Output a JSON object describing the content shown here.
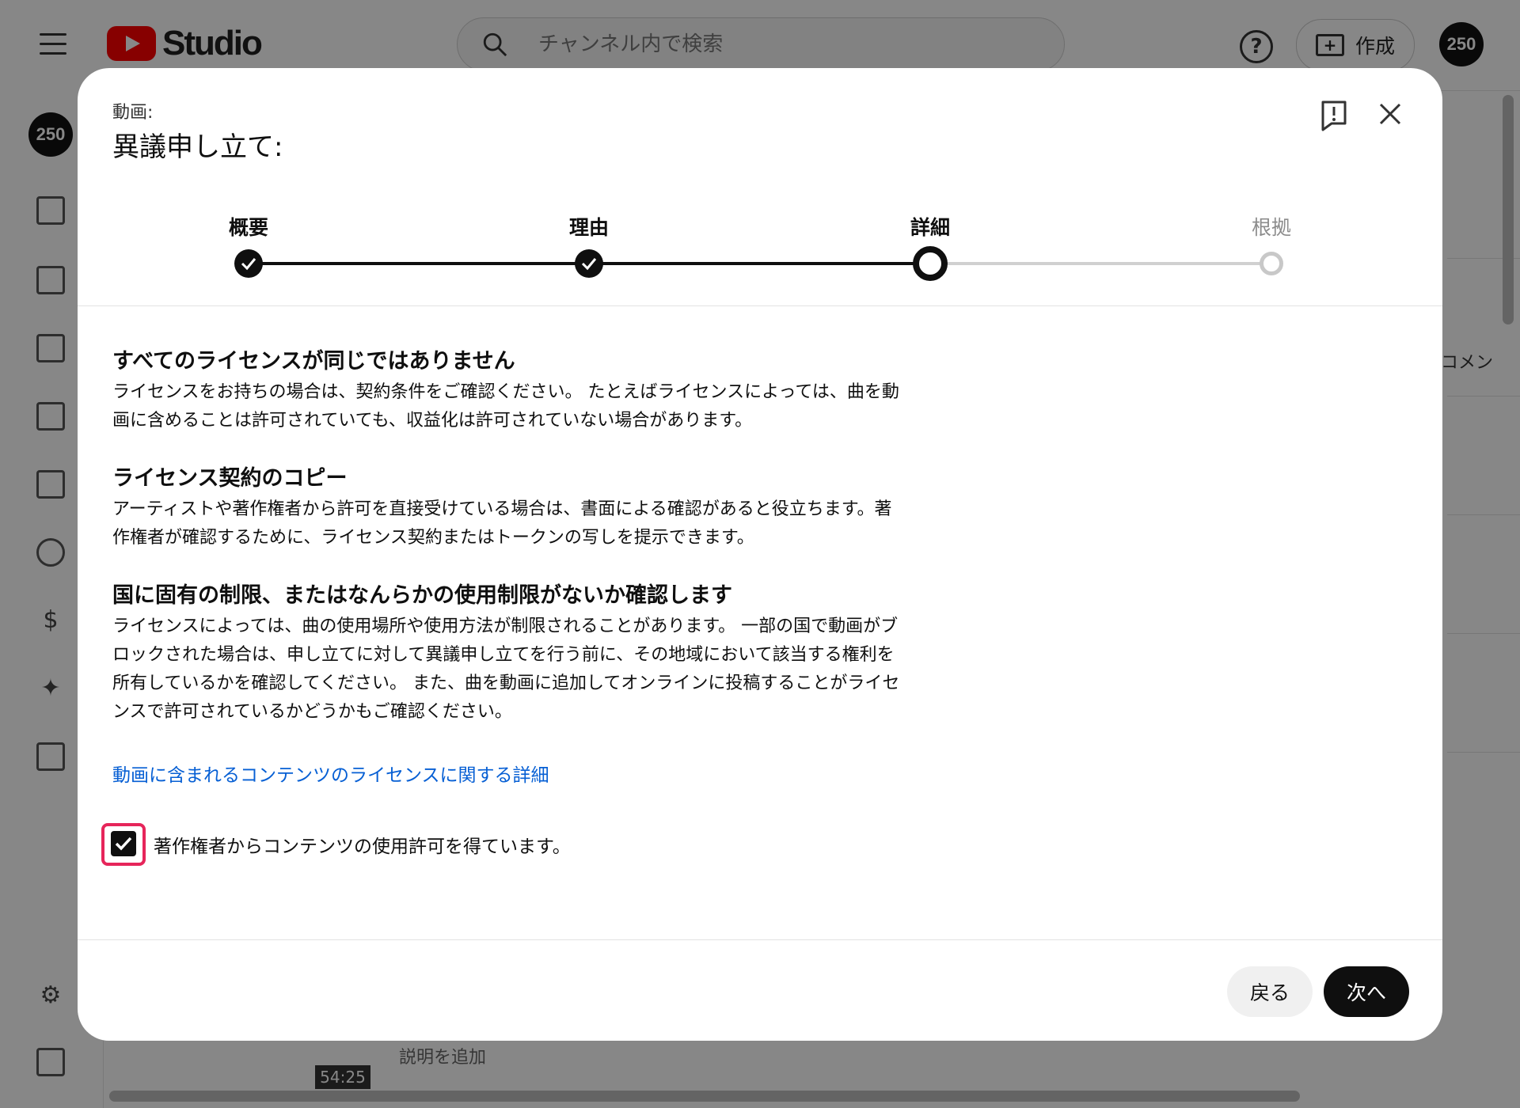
{
  "app": {
    "logo_text": "Studio",
    "search_placeholder": "チャンネル内で検索",
    "help_glyph": "?",
    "create_label": "作成",
    "avatar_text": "250",
    "bg_comment": "コメン",
    "bg_description": "説明を追加",
    "bg_duration": "54:25"
  },
  "dialog": {
    "label": "動画:",
    "title": "異議申し立て:",
    "steps": [
      {
        "label": "概要",
        "state": "done"
      },
      {
        "label": "理由",
        "state": "done"
      },
      {
        "label": "詳細",
        "state": "current"
      },
      {
        "label": "根拠",
        "state": "future"
      }
    ],
    "sections": [
      {
        "heading": "すべてのライセンスが同じではありません",
        "lines": [
          "ライセンスをお持ちの場合は、契約条件をご確認ください。 たとえばライセンスによっては、曲を動",
          "画に含めることは許可されていても、収益化は許可されていない場合があります。"
        ]
      },
      {
        "heading": "ライセンス契約のコピー",
        "lines": [
          "アーティストや著作権者から許可を直接受けている場合は、書面による確認があると役立ちます。著",
          "作権者が確認するために、ライセンス契約またはトークンの写しを提示できます。"
        ]
      },
      {
        "heading": "国に固有の制限、またはなんらかの使用制限がないか確認します",
        "lines": [
          "ライセンスによっては、曲の使用場所や使用方法が制限されることがあります。 一部の国で動画がブ",
          "ロックされた場合は、申し立てに対して異議申し立てを行う前に、その地域において該当する権利を",
          "所有しているかを確認してください。 また、曲を動画に追加してオンラインに投稿することがライセ",
          "ンスで許可されているかどうかもご確認ください。"
        ]
      }
    ],
    "link_text": "動画に含まれるコンテンツのライセンスに関する詳細",
    "checkbox_label": "著作権者からコンテンツの使用許可を得ています。",
    "checkbox_checked": true,
    "back_label": "戻る",
    "next_label": "次へ"
  },
  "colors": {
    "accent": "#0f0f0f",
    "link": "#065fd4",
    "highlight": "#e6255a",
    "youtube_red": "#ff0000"
  }
}
